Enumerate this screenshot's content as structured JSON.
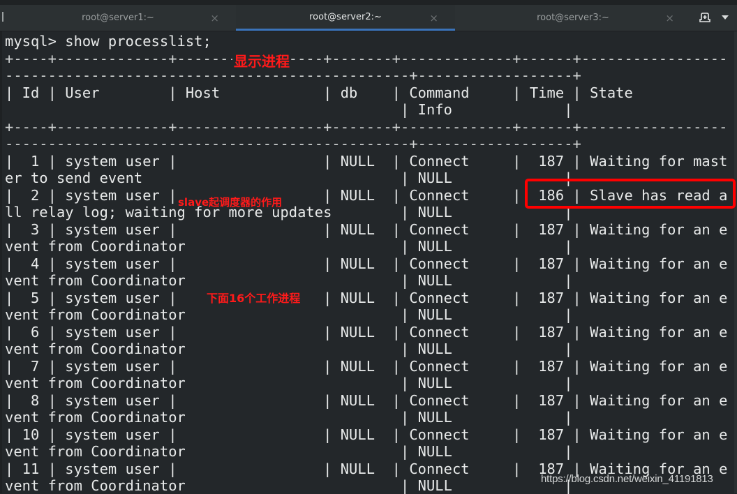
{
  "tabs": [
    {
      "title": "root@server1:~",
      "active": false,
      "close_icon": "×"
    },
    {
      "title": "root@server2:~",
      "active": true,
      "close_icon": "×"
    },
    {
      "title": "root@server3:~",
      "active": false,
      "close_icon": "×"
    }
  ],
  "tab_actions": {
    "new_tab_icon": "new-tab-icon",
    "menu_icon": "chevron-down-icon"
  },
  "terminal": {
    "lines": [
      "mysql> show processlist;",
      "+----+-------------+-----------------+-------+-------------+------+-----------------",
      "-----------------------------------------------+------------------+",
      "| Id | User        | Host            | db    | Command     | Time | State",
      "                                              | Info             |",
      "+----+-------------+-----------------+-------+-------------+------+-----------------",
      "-----------------------------------------------+------------------+",
      "|  1 | system user |                 | NULL  | Connect     |  187 | Waiting for mast",
      "er to send event                              | NULL             |",
      "|  2 | system user |                 | NULL  | Connect     |  186 | Slave has read a",
      "ll relay log; waiting for more updates        | NULL             |",
      "|  3 | system user |                 | NULL  | Connect     |  187 | Waiting for an e",
      "vent from Coordinator                         | NULL             |",
      "|  4 | system user |                 | NULL  | Connect     |  187 | Waiting for an e",
      "vent from Coordinator                         | NULL             |",
      "|  5 | system user |                 | NULL  | Connect     |  187 | Waiting for an e",
      "vent from Coordinator                         | NULL             |",
      "|  6 | system user |                 | NULL  | Connect     |  187 | Waiting for an e",
      "vent from Coordinator                         | NULL             |",
      "|  7 | system user |                 | NULL  | Connect     |  187 | Waiting for an e",
      "vent from Coordinator                         | NULL             |",
      "|  8 | system user |                 | NULL  | Connect     |  187 | Waiting for an e",
      "vent from Coordinator                         | NULL             |",
      "| 10 | system user |                 | NULL  | Connect     |  187 | Waiting for an e",
      "vent from Coordinator                         | NULL             |",
      "| 11 | system user |                 | NULL  | Connect     |  187 | Waiting for an e",
      "vent from Coordinator                         | NULL             |"
    ],
    "columns": [
      "Id",
      "User",
      "Host",
      "db",
      "Command",
      "Time",
      "State",
      "Info"
    ],
    "rows": [
      {
        "id": "1",
        "user": "system user",
        "host": "",
        "db": "NULL",
        "command": "Connect",
        "time": "187",
        "state": "Waiting for master to send event",
        "info": "NULL"
      },
      {
        "id": "2",
        "user": "system user",
        "host": "",
        "db": "NULL",
        "command": "Connect",
        "time": "186",
        "state": "Slave has read all relay log; waiting for more updates",
        "info": "NULL"
      },
      {
        "id": "3",
        "user": "system user",
        "host": "",
        "db": "NULL",
        "command": "Connect",
        "time": "187",
        "state": "Waiting for an event from Coordinator",
        "info": "NULL"
      },
      {
        "id": "4",
        "user": "system user",
        "host": "",
        "db": "NULL",
        "command": "Connect",
        "time": "187",
        "state": "Waiting for an event from Coordinator",
        "info": "NULL"
      },
      {
        "id": "5",
        "user": "system user",
        "host": "",
        "db": "NULL",
        "command": "Connect",
        "time": "187",
        "state": "Waiting for an event from Coordinator",
        "info": "NULL"
      },
      {
        "id": "6",
        "user": "system user",
        "host": "",
        "db": "NULL",
        "command": "Connect",
        "time": "187",
        "state": "Waiting for an event from Coordinator",
        "info": "NULL"
      },
      {
        "id": "7",
        "user": "system user",
        "host": "",
        "db": "NULL",
        "command": "Connect",
        "time": "187",
        "state": "Waiting for an event from Coordinator",
        "info": "NULL"
      },
      {
        "id": "8",
        "user": "system user",
        "host": "",
        "db": "NULL",
        "command": "Connect",
        "time": "187",
        "state": "Waiting for an event from Coordinator",
        "info": "NULL"
      },
      {
        "id": "10",
        "user": "system user",
        "host": "",
        "db": "NULL",
        "command": "Connect",
        "time": "187",
        "state": "Waiting for an event from Coordinator",
        "info": "NULL"
      },
      {
        "id": "11",
        "user": "system user",
        "host": "",
        "db": "NULL",
        "command": "Connect",
        "time": "187",
        "state": "Waiting for an event from Coordinator",
        "info": "NULL"
      }
    ]
  },
  "annotations": {
    "show_process": "显示进程",
    "slave_coordinator": "slave起调度器的作用",
    "workers": "下面16个工作进程"
  },
  "colors": {
    "terminal_bg": "#23272a",
    "terminal_fg": "#e8eaea",
    "annotation_red": "#ff1a1a",
    "highlight_box": "#ff0000",
    "active_tab_underline": "#3b73b9"
  },
  "watermark": "https://blog.csdn.net/weixin_41191813"
}
